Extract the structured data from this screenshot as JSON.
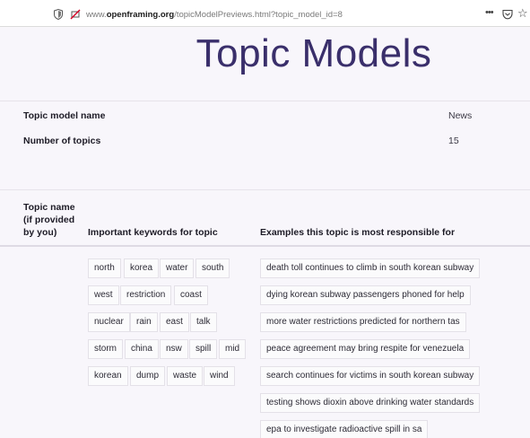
{
  "browser": {
    "url_prefix": "www.",
    "url_domain": "openframing.org",
    "url_path": "/topicModelPreviews.html?topic_model_id=8",
    "more_label": "•••",
    "star_label": "☆"
  },
  "page": {
    "title": "Topic Models"
  },
  "info": {
    "name_label": "Topic model name",
    "name_value": "News",
    "topics_label": "Number of topics",
    "topics_value": "15"
  },
  "table": {
    "col1_line1": "Topic name",
    "col1_line2": "(if provided",
    "col1_line3": "by you)",
    "col2": "Important keywords for topic",
    "col3": "Examples this topic is most responsible for"
  },
  "keywords": [
    [
      "north",
      "korea",
      "water",
      "south"
    ],
    [
      "west",
      "restriction",
      "coast"
    ],
    [
      "nuclear",
      "rain",
      "east",
      "talk"
    ],
    [
      "storm",
      "china",
      "nsw",
      "spill",
      "mid"
    ],
    [
      "korean",
      "dump",
      "waste",
      "wind"
    ]
  ],
  "examples": [
    "death toll continues to climb in south korean subway",
    "dying korean subway passengers phoned for help",
    "more water restrictions predicted for northern tas",
    "peace agreement may bring respite for venezuela",
    "search continues for victims in south korean subway",
    "testing shows dioxin above drinking water standards",
    "epa to investigate radioactive spill in sa"
  ],
  "icons": {
    "shield": "shield-icon",
    "permissions": "permissions-blocked-icon",
    "more": "more-icon",
    "pocket": "pocket-icon",
    "star": "bookmark-star-icon"
  }
}
